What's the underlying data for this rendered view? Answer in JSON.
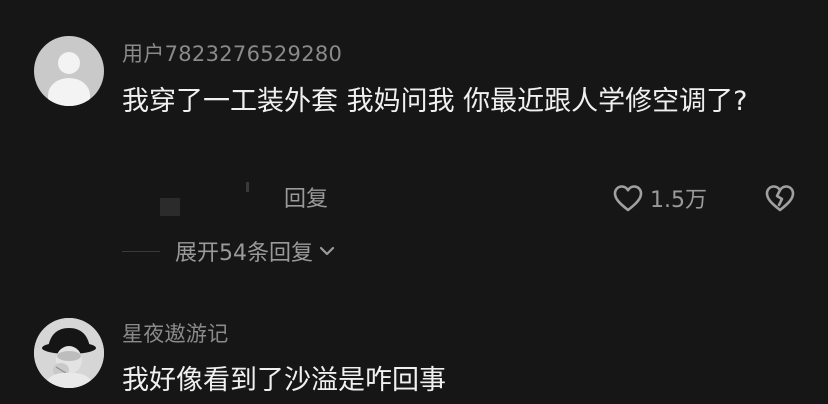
{
  "comments": [
    {
      "username": "用户7823276529280",
      "text": "我穿了一工装外套 我妈问我 你最近跟人学修空调了?",
      "reply_label": "回复",
      "like_count": "1.5万",
      "expand_label": "展开54条回复"
    },
    {
      "username": "星夜遨游记",
      "text": "我好像看到了沙溢是咋回事"
    }
  ],
  "icons": {
    "like": "heart-outline-icon",
    "dislike": "broken-heart-icon",
    "expand": "chevron-down-icon",
    "avatar_default": "default-user-avatar-icon"
  },
  "colors": {
    "background": "#161616",
    "primary_text": "#f0f0f0",
    "secondary_text": "#8a8a8a"
  }
}
